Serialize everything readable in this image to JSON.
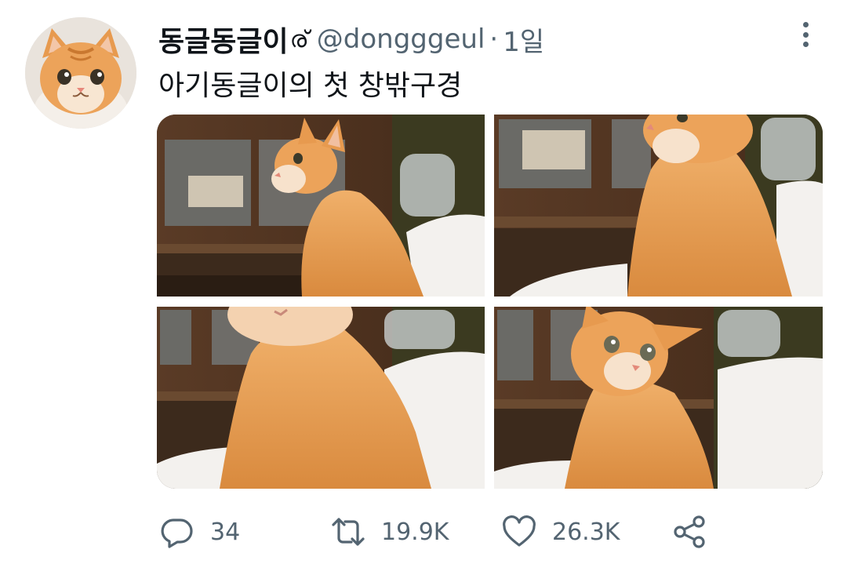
{
  "author": {
    "display_name": "동글동글이",
    "name_emoji": "ര്",
    "handle": "@dongggeul",
    "separator": "·",
    "time": "1일",
    "avatar_icon": "kitten-avatar"
  },
  "tweet": {
    "text": "아기동글이의 첫 창밖구경",
    "photos": [
      "kitten-photo-1",
      "kitten-photo-2",
      "kitten-photo-3",
      "kitten-photo-4"
    ]
  },
  "actions": {
    "reply": {
      "icon": "reply-icon",
      "count": "34"
    },
    "retweet": {
      "icon": "retweet-icon",
      "count": "19.9K"
    },
    "like": {
      "icon": "heart-icon",
      "count": "26.3K"
    },
    "share": {
      "icon": "share-icon"
    }
  },
  "colors": {
    "text": "#0f1419",
    "secondary": "#536471",
    "kitten_orange": "#e39a4c"
  }
}
